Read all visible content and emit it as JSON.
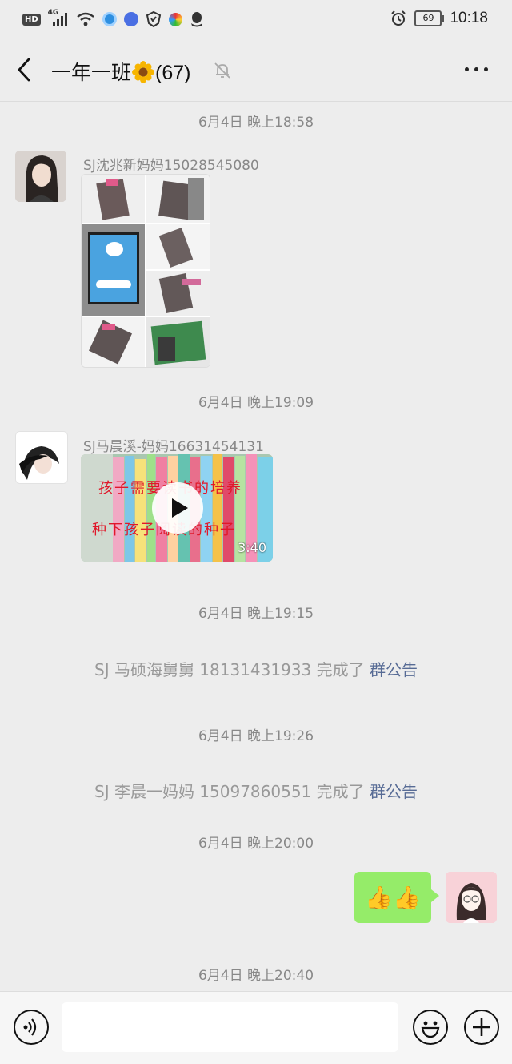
{
  "status_bar": {
    "hd": "HD",
    "network": "4G",
    "battery": "69",
    "time": "10:18"
  },
  "header": {
    "title_prefix": "一年一班",
    "title_suffix": "(67)",
    "icons": [
      "back-arrow-icon",
      "sunflower-icon",
      "mute-bell-icon",
      "more-icon"
    ]
  },
  "messages": {
    "ts1": "6月4日 晚上18:58",
    "m1_sender": "SJ沈兆新妈妈15028545080",
    "ts2": "6月4日 晚上19:09",
    "m2_sender": "SJ马晨溪-妈妈16631454131",
    "m2_video_duration": "3:40",
    "m2_video_caption1": "孩子需要读书的培养",
    "m2_video_caption2": "种下孩子阅读的种子",
    "ts3": "6月4日 晚上19:15",
    "sys1_text": "SJ 马硕海舅舅 18131431933 完成了 ",
    "sys1_link": "群公告",
    "ts4": "6月4日 晚上19:26",
    "sys2_text": "SJ 李晨一妈妈 15097860551 完成了 ",
    "sys2_link": "群公告",
    "ts5": "6月4日 晚上20:00",
    "my_message": "👍👍",
    "ts6": "6月4日 晚上20:40"
  },
  "colors": {
    "background": "#ededed",
    "bubble_me": "#95ec69",
    "link": "#576b95",
    "timestamp": "#888888"
  }
}
